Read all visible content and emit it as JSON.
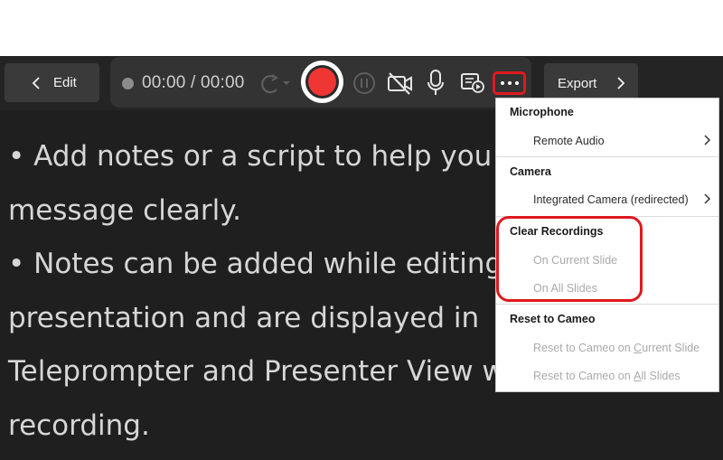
{
  "toolbar": {
    "edit_label": "Edit",
    "timer": "00:00 / 00:00",
    "export_label": "Export"
  },
  "icons": {
    "back": "chevron-left-icon",
    "retake": "retake-icon",
    "record": "record-icon",
    "pause": "pause-icon",
    "camera_off": "camera-off-icon",
    "microphone": "microphone-icon",
    "view": "presenter-view-icon",
    "more": "more-options-icon",
    "forward": "chevron-right-icon"
  },
  "colors": {
    "record": "#f03535",
    "highlight": "#e0191f",
    "background": "#1f1f1f",
    "menu_disabled": "#a9a9a9"
  },
  "notes": {
    "lines": [
      "• Add notes or a script to help you la",
      "message clearly.",
      "• Notes can be added while editing y",
      "presentation and are displayed in",
      "Teleprompter and Presenter View wh",
      "recording."
    ]
  },
  "menu": {
    "microphone_header": "Microphone",
    "remote_audio": "Remote Audio",
    "camera_header": "Camera",
    "integrated_camera": "Integrated Camera (redirected)",
    "clear_header": "Clear Recordings",
    "on_current_slide": "On Current Slide",
    "on_all_slides": "On All Slides",
    "reset_header": "Reset to Cameo",
    "reset_current_prefix": "Reset to Cameo on ",
    "reset_current_u": "C",
    "reset_current_rest": "urrent Slide",
    "reset_all_prefix": "Reset to Cameo on ",
    "reset_all_u": "A",
    "reset_all_rest": "ll Slides"
  }
}
